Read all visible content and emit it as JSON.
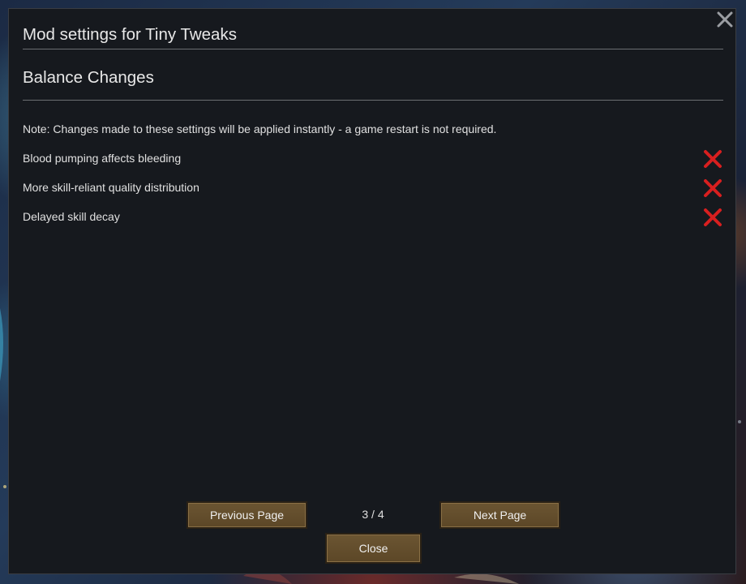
{
  "dialog": {
    "title": "Mod settings for Tiny Tweaks",
    "section_title": "Balance Changes",
    "note": "Note: Changes made to these settings will be applied instantly - a game restart is not required.",
    "settings": [
      {
        "label": "Blood pumping affects bleeding",
        "enabled": false,
        "icon": "red-x-icon"
      },
      {
        "label": "More skill-reliant quality distribution",
        "enabled": false,
        "icon": "red-x-icon"
      },
      {
        "label": "Delayed skill decay",
        "enabled": false,
        "icon": "red-x-icon"
      }
    ],
    "pagination": {
      "previous_label": "Previous Page",
      "next_label": "Next Page",
      "indicator": "3 / 4"
    },
    "close_label": "Close",
    "close_icon": "close-icon"
  },
  "colors": {
    "panel": "#16191e",
    "button": "#5c4727",
    "checkbox_off": "#d81f1f"
  }
}
